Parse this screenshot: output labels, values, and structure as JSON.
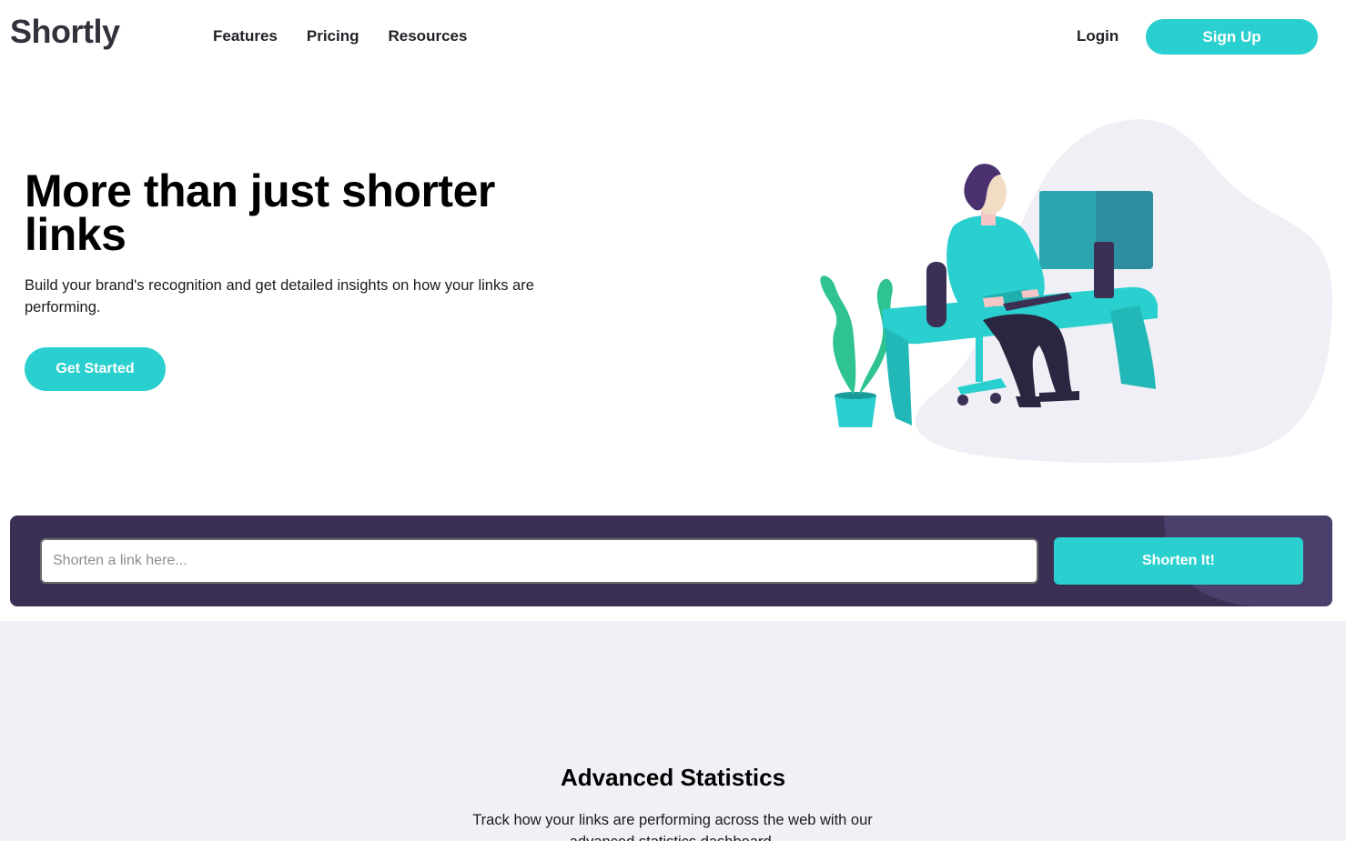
{
  "header": {
    "logo": "Shortly",
    "nav": [
      {
        "label": "Features"
      },
      {
        "label": "Pricing"
      },
      {
        "label": "Resources"
      }
    ],
    "login_label": "Login",
    "signup_label": "Sign Up"
  },
  "hero": {
    "title": "More than just shorter links",
    "subtitle": "Build your brand's recognition and get detailed insights on how your links are performing.",
    "cta_label": "Get Started",
    "illustration": "person-working-at-desk-illustration"
  },
  "shorten": {
    "placeholder": "Shorten a link here...",
    "button_label": "Shorten It!"
  },
  "stats": {
    "title": "Advanced Statistics",
    "subtitle": "Track how your links are performing across the web with our advanced statistics dashboard."
  },
  "colors": {
    "accent": "#2acfcf",
    "dark_violet": "#3b3054",
    "light_gray_bg": "#f0f1f6",
    "logo": "#34313d"
  }
}
